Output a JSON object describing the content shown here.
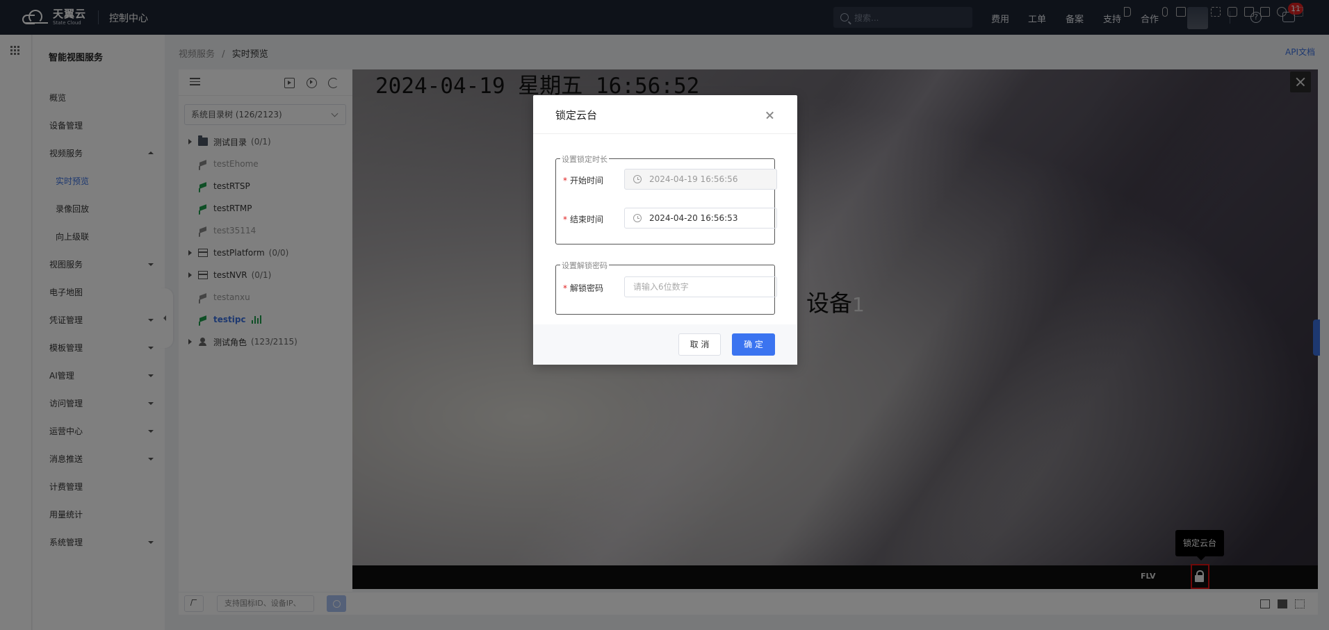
{
  "header": {
    "brand": "天翼云",
    "brand_sub": "State Cloud",
    "console": "控制中心",
    "search_placeholder": "搜索...",
    "nav": [
      "费用",
      "工单",
      "备案",
      "支持",
      "合作"
    ],
    "message_badge": "11"
  },
  "sidebar": {
    "title": "智能视图服务",
    "items": [
      {
        "label": "概览"
      },
      {
        "label": "设备管理"
      },
      {
        "label": "视频服务"
      },
      {
        "label": "实时预览"
      },
      {
        "label": "录像回放"
      },
      {
        "label": "向上级联"
      },
      {
        "label": "视图服务"
      },
      {
        "label": "电子地图"
      },
      {
        "label": "凭证管理"
      },
      {
        "label": "模板管理"
      },
      {
        "label": "AI管理"
      },
      {
        "label": "访问管理"
      },
      {
        "label": "运营中心"
      },
      {
        "label": "消息推送"
      },
      {
        "label": "计费管理"
      },
      {
        "label": "用量统计"
      },
      {
        "label": "系统管理"
      }
    ]
  },
  "breadcrumb": {
    "parent": "视频服务",
    "sep": "/",
    "current": "实时预览"
  },
  "api_doc": "API文档",
  "tree": {
    "select_value": "系统目录树 (126/2123)",
    "nodes": [
      {
        "label": "测试目录",
        "count": "(0/1)"
      },
      {
        "label": "testEhome"
      },
      {
        "label": "testRTSP"
      },
      {
        "label": "testRTMP"
      },
      {
        "label": "test35114"
      },
      {
        "label": "testPlatform",
        "count": "(0/0)"
      },
      {
        "label": "testNVR",
        "count": "(0/1)"
      },
      {
        "label": "testanxu"
      },
      {
        "label": "testipc"
      },
      {
        "label": "测试角色",
        "count": "(123/2115)"
      }
    ],
    "bottom_input_placeholder": "支持国标ID、设备IP、"
  },
  "video": {
    "osd_text": "2024-04-19 星期五 16:56:52",
    "device_name": "设备",
    "device_index": "1",
    "format": "FLV",
    "tooltip": "锁定云台"
  },
  "modal": {
    "title": "锁定云台",
    "section_time": "设置锁定时长",
    "start_label": "开始时间",
    "start_value": "2024-04-19 16:56:56",
    "end_label": "结束时间",
    "end_value": "2024-04-20 16:56:53",
    "section_pwd": "设置解锁密码",
    "pwd_label": "解锁密码",
    "pwd_placeholder": "请输入6位数字",
    "cancel": "取 消",
    "ok": "确 定"
  },
  "colors": {
    "primary": "#3b74f0",
    "topbar": "#1d2533",
    "danger": "#e02020",
    "online": "#1f9f4c"
  }
}
